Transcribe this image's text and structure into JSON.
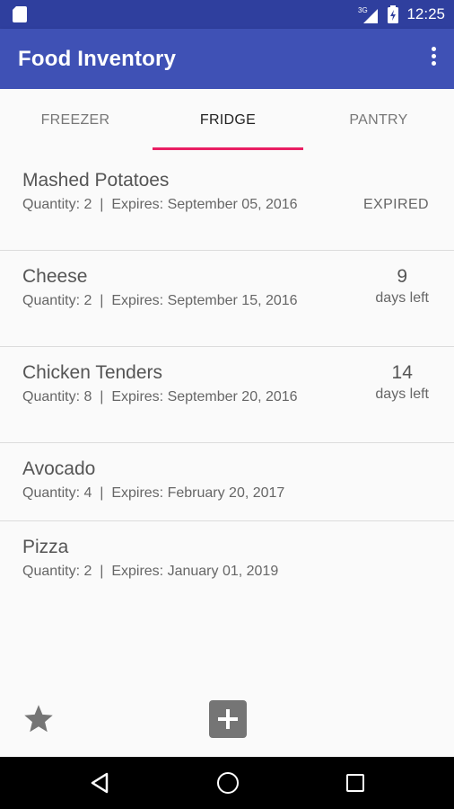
{
  "status_bar": {
    "time": "12:25",
    "network": "3G",
    "icons": [
      "sd-card-icon",
      "signal-icon",
      "battery-icon"
    ]
  },
  "app_bar": {
    "title": "Food Inventory",
    "overflow_icon": "more-vert-icon"
  },
  "tabs": [
    {
      "label": "FREEZER",
      "active": false
    },
    {
      "label": "FRIDGE",
      "active": true
    },
    {
      "label": "PANTRY",
      "active": false
    }
  ],
  "colors": {
    "primary": "#3f51b5",
    "primary_dark": "#2f3f9e",
    "accent": "#e91e63"
  },
  "items": [
    {
      "name": "Mashed Potatoes",
      "quantity_label": "Quantity:",
      "quantity": "2",
      "separator": "|",
      "expires_label": "Expires:",
      "expires": "September 05, 2016",
      "status_text": "EXPIRED"
    },
    {
      "name": "Cheese",
      "quantity_label": "Quantity:",
      "quantity": "2",
      "separator": "|",
      "expires_label": "Expires:",
      "expires": "September 15, 2016",
      "days": "9",
      "days_label": "days left"
    },
    {
      "name": "Chicken Tenders",
      "quantity_label": "Quantity:",
      "quantity": "8",
      "separator": "|",
      "expires_label": "Expires:",
      "expires": "September 20, 2016",
      "days": "14",
      "days_label": "days left"
    },
    {
      "name": "Avocado",
      "quantity_label": "Quantity:",
      "quantity": "4",
      "separator": "|",
      "expires_label": "Expires:",
      "expires": "February 20, 2017"
    },
    {
      "name": "Pizza",
      "quantity_label": "Quantity:",
      "quantity": "2",
      "separator": "|",
      "expires_label": "Expires:",
      "expires": "January 01, 2019"
    }
  ],
  "bottom_actions": {
    "favorite_icon": "star-icon",
    "add_icon": "add-box-icon"
  },
  "nav_bar": {
    "icons": [
      "back-icon",
      "home-icon",
      "recents-icon"
    ]
  }
}
